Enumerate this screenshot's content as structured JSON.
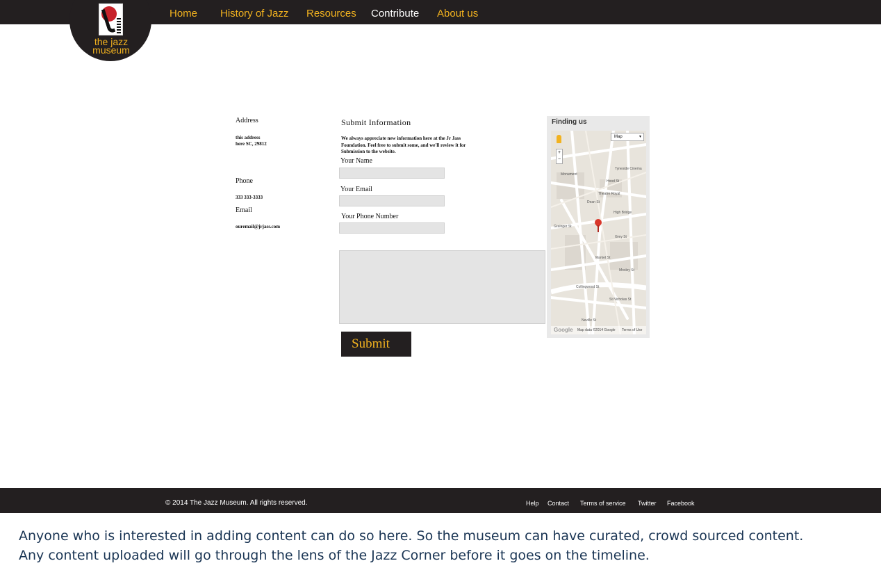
{
  "logo": {
    "line1": "the  jazz",
    "line2": "museum"
  },
  "nav": [
    {
      "label": "Home"
    },
    {
      "label": "History of Jazz"
    },
    {
      "label": "Resources"
    },
    {
      "label": "Contribute"
    },
    {
      "label": "About us"
    }
  ],
  "colors": {
    "accent": "#f2b21f",
    "bar": "#231f20",
    "field": "#e4e4e4",
    "caption": "#1a3554"
  },
  "contact": {
    "address_label": "Address",
    "address_line1": "this address",
    "address_line2": "here SC, 29812",
    "phone_label": "Phone",
    "phone_value": "333 333-3333",
    "email_label": "Email",
    "email_value": "ouremail@jrjass.com"
  },
  "form": {
    "title": "Submit Information",
    "description": "We always appreciate new information here at the Jr Jass Foundation. Feel free to submit some, and we'll review it for Submission to the website.",
    "name_label": "Your Name",
    "email_label": "Your Email",
    "phone_label": "Your Phone Number",
    "submit_label": "Submit"
  },
  "map": {
    "title": "Finding us",
    "type_select": "Map",
    "streets": [
      "Monument",
      "Tyneside Cinema",
      "Theatre Royal",
      "High Bridge",
      "Grey St",
      "Dean St",
      "Collingwood St",
      "Mosley St",
      "St Nicholas St",
      "Neville St",
      "Grainger St",
      "Hood St",
      "Market St"
    ],
    "google_logo": "Google",
    "map_data": "Map data ©2014 Google",
    "terms": "Terms of Use"
  },
  "footer": {
    "copyright": "© 2014 The Jazz Museum. All rights reserved.",
    "links": [
      "Help",
      "Contact",
      "Terms of service",
      "Twitter",
      "Facebook"
    ]
  },
  "caption": {
    "line1": "Anyone who is interested in adding content can do so here. So the museum can have curated, crowd sourced content.",
    "line2": "Any content uploaded will go through the lens of the Jazz Corner before it goes on the timeline."
  }
}
